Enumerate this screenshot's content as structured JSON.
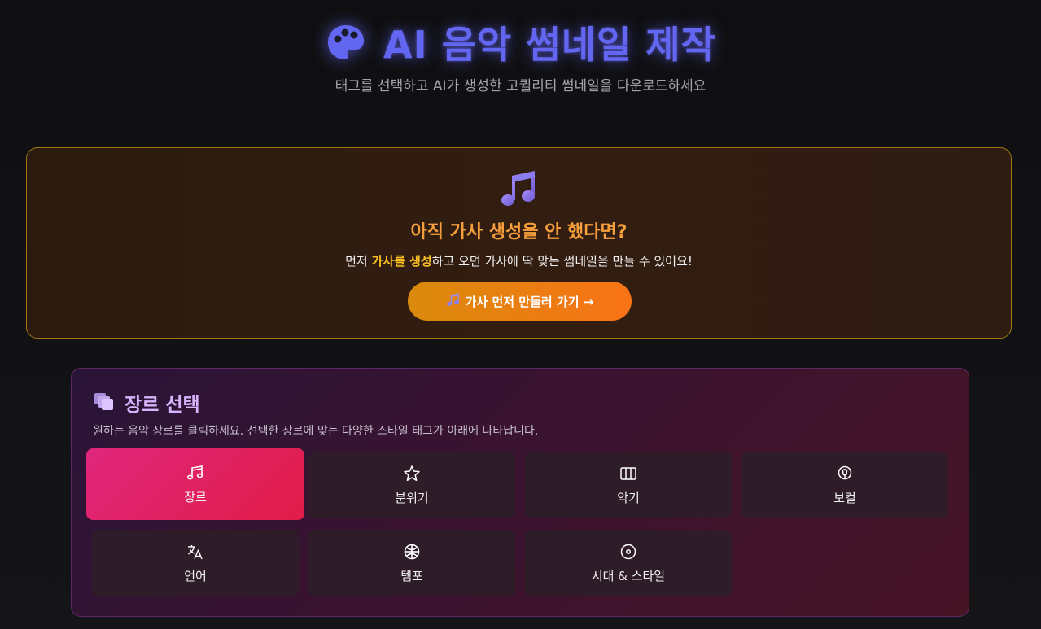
{
  "header": {
    "title_icon": "palette-icon",
    "title": "AI 음악 썸네일 제작",
    "subtitle": "태그를 선택하고 AI가 생성한 고퀄리티 썸네일을 다운로드하세요"
  },
  "lyrics_prompt": {
    "icon": "music-notes-icon",
    "title": "아직 가사 생성을 안 했다면?",
    "desc_before": "먼저 ",
    "desc_highlight": "가사를 생성",
    "desc_after": "하고 오면 가사에 딱 맞는 썸네일을 만들 수 있어요!",
    "button_icon": "music-notes-icon",
    "button_label": "가사 먼저 만들러 가기 →"
  },
  "genre_section": {
    "icon": "layers-icon",
    "title": "장르 선택",
    "description": "원하는 음악 장르를 클릭하세요. 선택한 장르에 맞는 다양한 스타일 태그가 아래에 나타납니다.",
    "categories": [
      {
        "label": "장르",
        "icon": "music-note-icon",
        "active": true
      },
      {
        "label": "분위기",
        "icon": "star-icon",
        "active": false
      },
      {
        "label": "악기",
        "icon": "piano-keys-icon",
        "active": false
      },
      {
        "label": "보컬",
        "icon": "microphone-icon",
        "active": false
      },
      {
        "label": "언어",
        "icon": "translate-icon",
        "active": false
      },
      {
        "label": "템포",
        "icon": "metronome-icon",
        "active": false
      },
      {
        "label": "시대 & 스타일",
        "icon": "disc-icon",
        "active": false
      }
    ]
  },
  "colors": {
    "title_accent": "#6366f1",
    "prompt_title": "#f59e3b",
    "highlight": "#fbbf24",
    "button_start": "#d98a0b",
    "button_end": "#f97316",
    "active_tile": "#e11d48",
    "section_title": "#d8b4fe"
  }
}
